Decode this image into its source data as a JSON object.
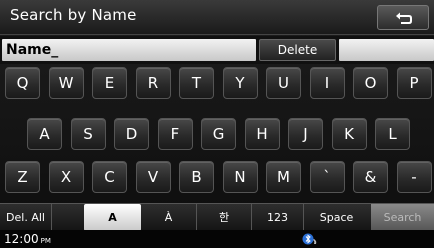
{
  "header": {
    "title": "Search by Name",
    "back_icon": "back-arrow-icon"
  },
  "name_row": {
    "value": "Name_",
    "delete_label": "Delete"
  },
  "keyboard": {
    "row1": [
      "Q",
      "W",
      "E",
      "R",
      "T",
      "Y",
      "U",
      "I",
      "O",
      "P"
    ],
    "row2": [
      "A",
      "S",
      "D",
      "F",
      "G",
      "H",
      "J",
      "K",
      "L"
    ],
    "row3": [
      "Z",
      "X",
      "C",
      "V",
      "B",
      "N",
      "M",
      "`",
      "&",
      "-"
    ]
  },
  "bottom_bar": {
    "del_all": "Del. All",
    "latin": "A",
    "accent": "À",
    "korean": "한",
    "numeric": "123",
    "space": "Space",
    "search": "Search"
  },
  "status": {
    "time": "12:00",
    "ampm": "PM",
    "connection_icon": "bluetooth-phone-icon"
  },
  "colors": {
    "key_bg": "#2a2a2a",
    "active_tab": "#ffffff",
    "field_bg": "#e0e0e0"
  }
}
